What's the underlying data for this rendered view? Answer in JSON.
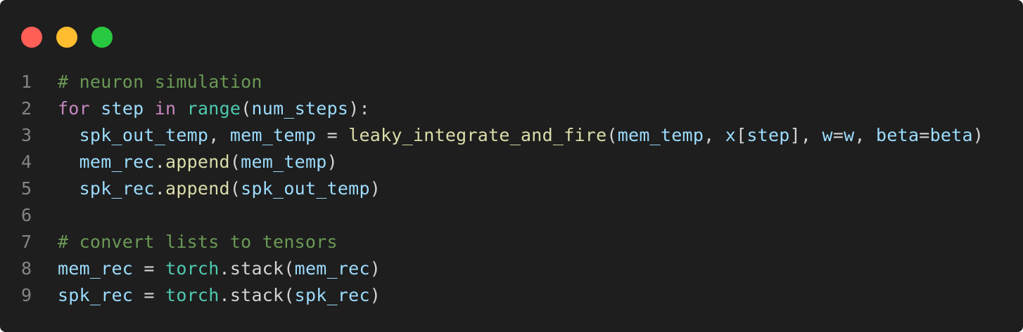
{
  "window": {
    "controls": [
      {
        "name": "close",
        "color": "#ff5f57"
      },
      {
        "name": "minimize",
        "color": "#febc2e"
      },
      {
        "name": "maximize",
        "color": "#28c840"
      }
    ]
  },
  "colors": {
    "background": "#1e1e1e",
    "line_number": "#858585",
    "comment": "#6a9955",
    "keyword": "#c586c0",
    "variable": "#9cdcfe",
    "builtin": "#4ec9b0",
    "function": "#dcdcaa",
    "plain": "#d4d4d4"
  },
  "code": {
    "lines": [
      {
        "number": "1",
        "tokens": [
          {
            "text": "# neuron simulation",
            "type": "comment"
          }
        ]
      },
      {
        "number": "2",
        "tokens": [
          {
            "text": "for",
            "type": "keyword"
          },
          {
            "text": " ",
            "type": "plain"
          },
          {
            "text": "step",
            "type": "variable"
          },
          {
            "text": " ",
            "type": "plain"
          },
          {
            "text": "in",
            "type": "keyword"
          },
          {
            "text": " ",
            "type": "plain"
          },
          {
            "text": "range",
            "type": "builtin"
          },
          {
            "text": "(",
            "type": "plain"
          },
          {
            "text": "num_steps",
            "type": "variable"
          },
          {
            "text": "):",
            "type": "plain"
          }
        ]
      },
      {
        "number": "3",
        "tokens": [
          {
            "text": "  ",
            "type": "plain"
          },
          {
            "text": "spk_out_temp",
            "type": "variable"
          },
          {
            "text": ", ",
            "type": "plain"
          },
          {
            "text": "mem_temp",
            "type": "variable"
          },
          {
            "text": " = ",
            "type": "plain"
          },
          {
            "text": "leaky_integrate_and_fire",
            "type": "function"
          },
          {
            "text": "(",
            "type": "plain"
          },
          {
            "text": "mem_temp",
            "type": "variable"
          },
          {
            "text": ", ",
            "type": "plain"
          },
          {
            "text": "x",
            "type": "variable"
          },
          {
            "text": "[",
            "type": "plain"
          },
          {
            "text": "step",
            "type": "variable"
          },
          {
            "text": "], ",
            "type": "plain"
          },
          {
            "text": "w",
            "type": "variable"
          },
          {
            "text": "=",
            "type": "plain"
          },
          {
            "text": "w",
            "type": "variable"
          },
          {
            "text": ", ",
            "type": "plain"
          },
          {
            "text": "beta",
            "type": "variable"
          },
          {
            "text": "=",
            "type": "plain"
          },
          {
            "text": "beta",
            "type": "variable"
          },
          {
            "text": ")",
            "type": "plain"
          }
        ]
      },
      {
        "number": "4",
        "tokens": [
          {
            "text": "  ",
            "type": "plain"
          },
          {
            "text": "mem_rec",
            "type": "variable"
          },
          {
            "text": ".",
            "type": "plain"
          },
          {
            "text": "append",
            "type": "function"
          },
          {
            "text": "(",
            "type": "plain"
          },
          {
            "text": "mem_temp",
            "type": "variable"
          },
          {
            "text": ")",
            "type": "plain"
          }
        ]
      },
      {
        "number": "5",
        "tokens": [
          {
            "text": "  ",
            "type": "plain"
          },
          {
            "text": "spk_rec",
            "type": "variable"
          },
          {
            "text": ".",
            "type": "plain"
          },
          {
            "text": "append",
            "type": "function"
          },
          {
            "text": "(",
            "type": "plain"
          },
          {
            "text": "spk_out_temp",
            "type": "variable"
          },
          {
            "text": ")",
            "type": "plain"
          }
        ]
      },
      {
        "number": "6",
        "tokens": []
      },
      {
        "number": "7",
        "tokens": [
          {
            "text": "# convert lists to tensors",
            "type": "comment"
          }
        ]
      },
      {
        "number": "8",
        "tokens": [
          {
            "text": "mem_rec",
            "type": "variable"
          },
          {
            "text": " = ",
            "type": "plain"
          },
          {
            "text": "torch",
            "type": "builtin"
          },
          {
            "text": ".",
            "type": "plain"
          },
          {
            "text": "stack",
            "type": "plain"
          },
          {
            "text": "(",
            "type": "plain"
          },
          {
            "text": "mem_rec",
            "type": "variable"
          },
          {
            "text": ")",
            "type": "plain"
          }
        ]
      },
      {
        "number": "9",
        "tokens": [
          {
            "text": "spk_rec",
            "type": "variable"
          },
          {
            "text": " = ",
            "type": "plain"
          },
          {
            "text": "torch",
            "type": "builtin"
          },
          {
            "text": ".",
            "type": "plain"
          },
          {
            "text": "stack",
            "type": "plain"
          },
          {
            "text": "(",
            "type": "plain"
          },
          {
            "text": "spk_rec",
            "type": "variable"
          },
          {
            "text": ")",
            "type": "plain"
          }
        ]
      }
    ]
  }
}
